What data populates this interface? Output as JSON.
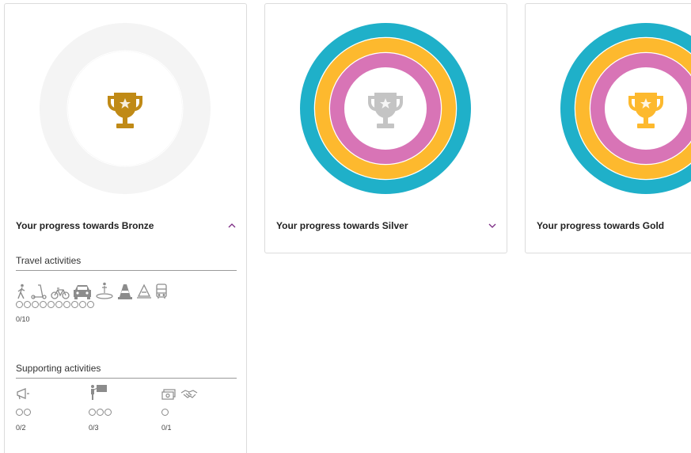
{
  "cards": {
    "bronze": {
      "title": "Your progress towards Bronze",
      "chevron": "chevron-up-icon",
      "trophy_color": "#c08a16",
      "travel": {
        "title": "Travel activities",
        "icons": [
          "walking-icon",
          "scooter-icon",
          "bicycle-icon",
          "car-icon",
          "park-and-ride-icon",
          "traffic-cone-icon",
          "carpool-icon",
          "bus-icon"
        ],
        "circles": 10,
        "count": "0/10"
      },
      "supporting": {
        "title": "Supporting activities",
        "columns": [
          {
            "icons": [
              "megaphone-icon"
            ],
            "circles": 2,
            "count": "0/2"
          },
          {
            "icons": [
              "presenter-icon"
            ],
            "circles": 3,
            "count": "0/3"
          },
          {
            "icons": [
              "money-icon",
              "handshake-icon"
            ],
            "circles": 1,
            "count": "0/1"
          }
        ]
      }
    },
    "silver": {
      "title": "Your progress towards Silver",
      "chevron": "chevron-down-icon",
      "trophy_color": "#c4c4c4"
    },
    "gold": {
      "title": "Your progress towards Gold",
      "trophy_color": "#fdb92e"
    }
  },
  "colors": {
    "accent_purple": "#7b2a83",
    "ring_teal": "#1fb0c9",
    "ring_yellow": "#fdb92e",
    "ring_pink": "#d874b6",
    "ring_empty": "#f3f3f3"
  }
}
